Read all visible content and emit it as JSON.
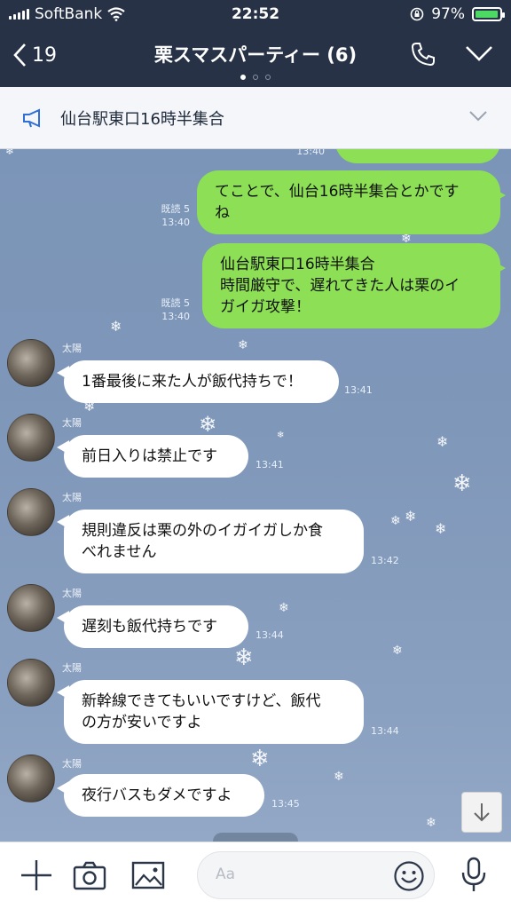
{
  "status_bar": {
    "carrier": "SoftBank",
    "time": "22:52",
    "battery": "97%",
    "battery_level": 0.97
  },
  "header": {
    "back_count": "19",
    "title": "栗スマスパーティー (6)"
  },
  "announcement": {
    "text": "仙台駅東口16時半集合"
  },
  "messages": {
    "m0": {
      "time": "13:40"
    },
    "m1": {
      "line1": "てことで、仙台16時半集合とかです",
      "line2": "ね",
      "read": "既読 5",
      "time": "13:40"
    },
    "m2": {
      "line1": "仙台駅東口16時半集合",
      "line2": "時間厳守で、遅れてきた人は栗のイ",
      "line3": "ガイガ攻撃！",
      "read": "既読 5",
      "time": "13:40"
    },
    "m3": {
      "sender": "太陽",
      "line1": "1番最後に来た人が飯代持ちで！",
      "time": "13:41"
    },
    "m4": {
      "sender": "太陽",
      "line1": "前日入りは禁止です",
      "time": "13:41"
    },
    "m5": {
      "sender": "太陽",
      "line1": "規則違反は栗の外のイガイガしか食",
      "line2": "べれません",
      "time": "13:42"
    },
    "m6": {
      "sender": "太陽",
      "line1": "遅刻も飯代持ちです",
      "time": "13:44"
    },
    "m7": {
      "sender": "太陽",
      "line1": "新幹線できてもいいですけど、飯代",
      "line2": "の方が安いですよ",
      "time": "13:44"
    },
    "m8": {
      "sender": "太陽",
      "line1": "夜行バスもダメですよ",
      "time": "13:45"
    }
  },
  "composer": {
    "placeholder": "Aa"
  },
  "icons": [
    "wifi-icon",
    "lock-rotation-icon",
    "back-icon",
    "phone-icon",
    "chevron-down-icon",
    "megaphone-icon",
    "snowflake-icon",
    "arrow-down-icon",
    "plus-icon",
    "camera-icon",
    "image-icon",
    "emoji-icon",
    "microphone-icon"
  ],
  "colors": {
    "header": "#273246",
    "green_bubble": "#8de055",
    "chat_bg": "#7f97b9"
  }
}
